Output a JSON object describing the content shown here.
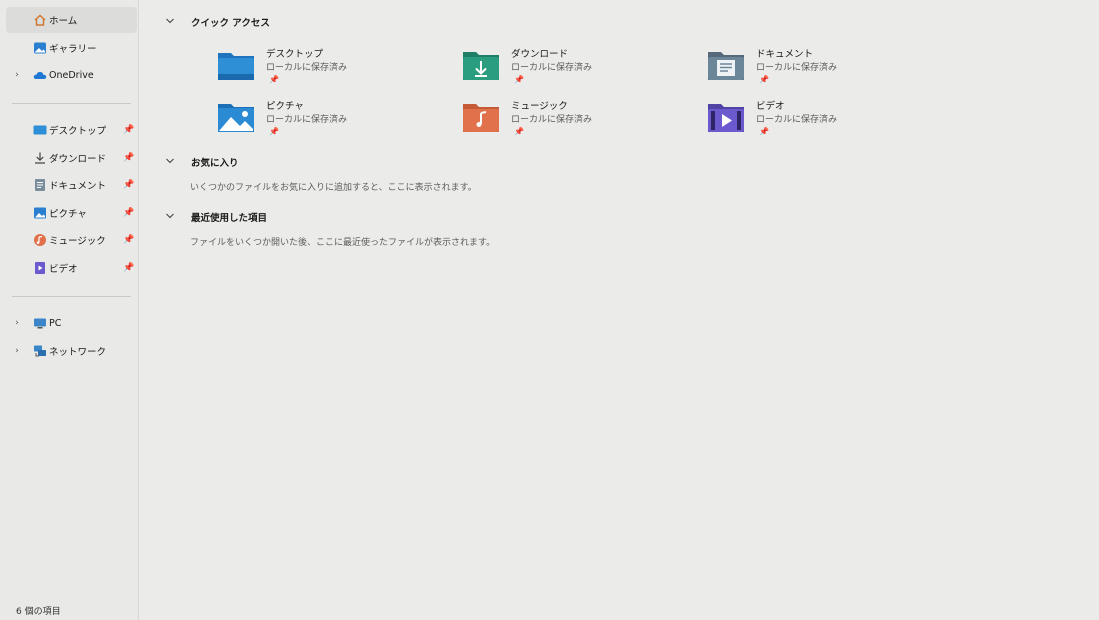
{
  "sidebar": {
    "home": "ホーム",
    "gallery": "ギャラリー",
    "onedrive": "OneDrive",
    "pinned": [
      {
        "label": "デスクトップ",
        "icon": "desktop-icon"
      },
      {
        "label": "ダウンロード",
        "icon": "download-icon"
      },
      {
        "label": "ドキュメント",
        "icon": "document-icon"
      },
      {
        "label": "ピクチャ",
        "icon": "pictures-icon"
      },
      {
        "label": "ミュージック",
        "icon": "music-icon"
      },
      {
        "label": "ビデオ",
        "icon": "video-icon"
      }
    ],
    "pc": "PC",
    "network": "ネットワーク"
  },
  "quick_access": {
    "title": "クイック アクセス",
    "items": [
      {
        "name": "デスクトップ",
        "sub": "ローカルに保存済み"
      },
      {
        "name": "ダウンロード",
        "sub": "ローカルに保存済み"
      },
      {
        "name": "ドキュメント",
        "sub": "ローカルに保存済み"
      },
      {
        "name": "ピクチャ",
        "sub": "ローカルに保存済み"
      },
      {
        "name": "ミュージック",
        "sub": "ローカルに保存済み"
      },
      {
        "name": "ビデオ",
        "sub": "ローカルに保存済み"
      }
    ]
  },
  "favorites": {
    "title": "お気に入り",
    "desc": "いくつかのファイルをお気に入りに追加すると、ここに表示されます。"
  },
  "recent": {
    "title": "最近使用した項目",
    "desc": "ファイルをいくつか開いた後、ここに最近使ったファイルが表示されます。"
  },
  "status": {
    "count": "6 個の項目"
  },
  "colors": {
    "desktop_folder": "#2f8fd6",
    "download_folder": "#2a9d7f",
    "document_folder": "#6b8599",
    "pictures_folder": "#2a8ad4",
    "music_folder": "#e0714a",
    "video_folder": "#6a5acd"
  }
}
